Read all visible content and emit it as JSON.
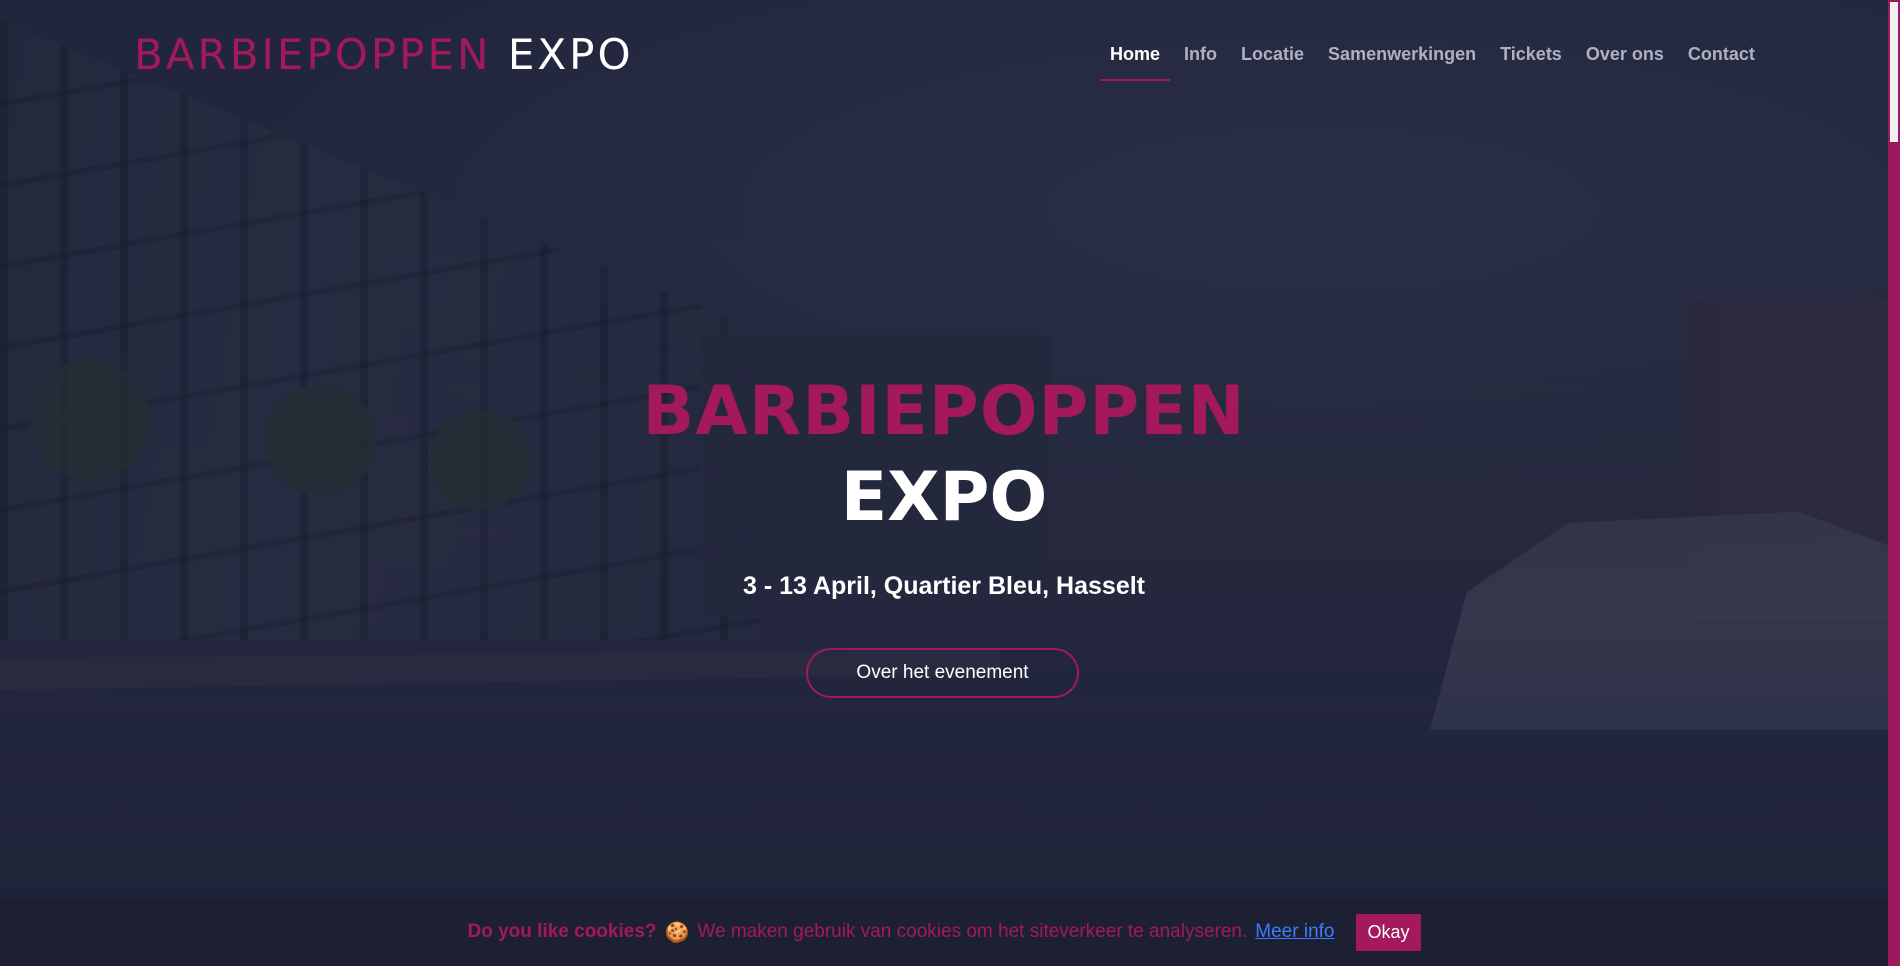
{
  "header": {
    "logo_part1": "BARBIEPOPPEN",
    "logo_part2": "EXPO"
  },
  "nav": {
    "items": [
      {
        "label": "Home",
        "active": true
      },
      {
        "label": "Info"
      },
      {
        "label": "Locatie"
      },
      {
        "label": "Samenwerkingen"
      },
      {
        "label": "Tickets"
      },
      {
        "label": "Over ons"
      },
      {
        "label": "Contact"
      }
    ]
  },
  "hero": {
    "title_line1": "BARBIEPOPPEN",
    "title_line2": "EXPO",
    "subtitle": "3 - 13 April, Quartier Bleu, Hasselt",
    "button_label": "Over het evenement"
  },
  "cookie": {
    "question": "Do you like cookies?",
    "icon": "cookie-icon",
    "message": "We maken gebruik van cookies om het siteverkeer te analyseren.",
    "more_link": "Meer info",
    "ok_label": "Okay"
  },
  "colors": {
    "accent": "#a3195b",
    "background": "#20253a",
    "link": "#3b7cff"
  }
}
